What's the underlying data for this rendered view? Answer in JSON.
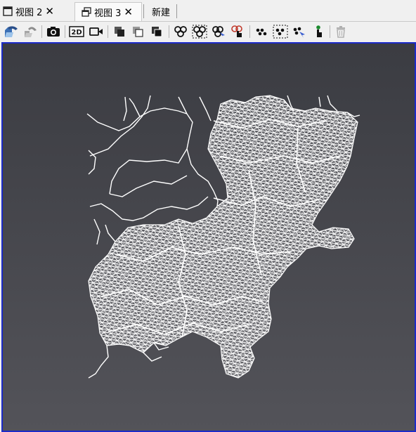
{
  "tabs": [
    {
      "label": "视图 2",
      "active": false,
      "icon": "window-icon"
    },
    {
      "label": "视图 3",
      "active": true,
      "icon": "restore-window-icon"
    },
    {
      "label": "新建",
      "active": false
    }
  ],
  "toolbar": {
    "groups": [
      [
        "load-state-icon",
        "save-state-icon"
      ],
      [
        "camera-icon"
      ],
      [
        "2d-mode-icon",
        "video-camera-icon"
      ],
      [
        "select-cells-icon",
        "select-points-icon",
        "select-block-icon"
      ],
      [
        "cell-selection-icon",
        "cell-frustum-icon",
        "cell-interactive-icon",
        "hover-cell-icon"
      ],
      [
        "point-selection-icon",
        "point-frustum-icon",
        "point-interactive-icon",
        "hover-point-icon"
      ],
      [
        "delete-icon"
      ]
    ],
    "twod_label": "2D"
  },
  "viewport": {
    "background_top": "#3b3c42",
    "background_bottom": "#535359",
    "border_color": "#1c2bc8",
    "mesh_color": "#ffffff"
  }
}
